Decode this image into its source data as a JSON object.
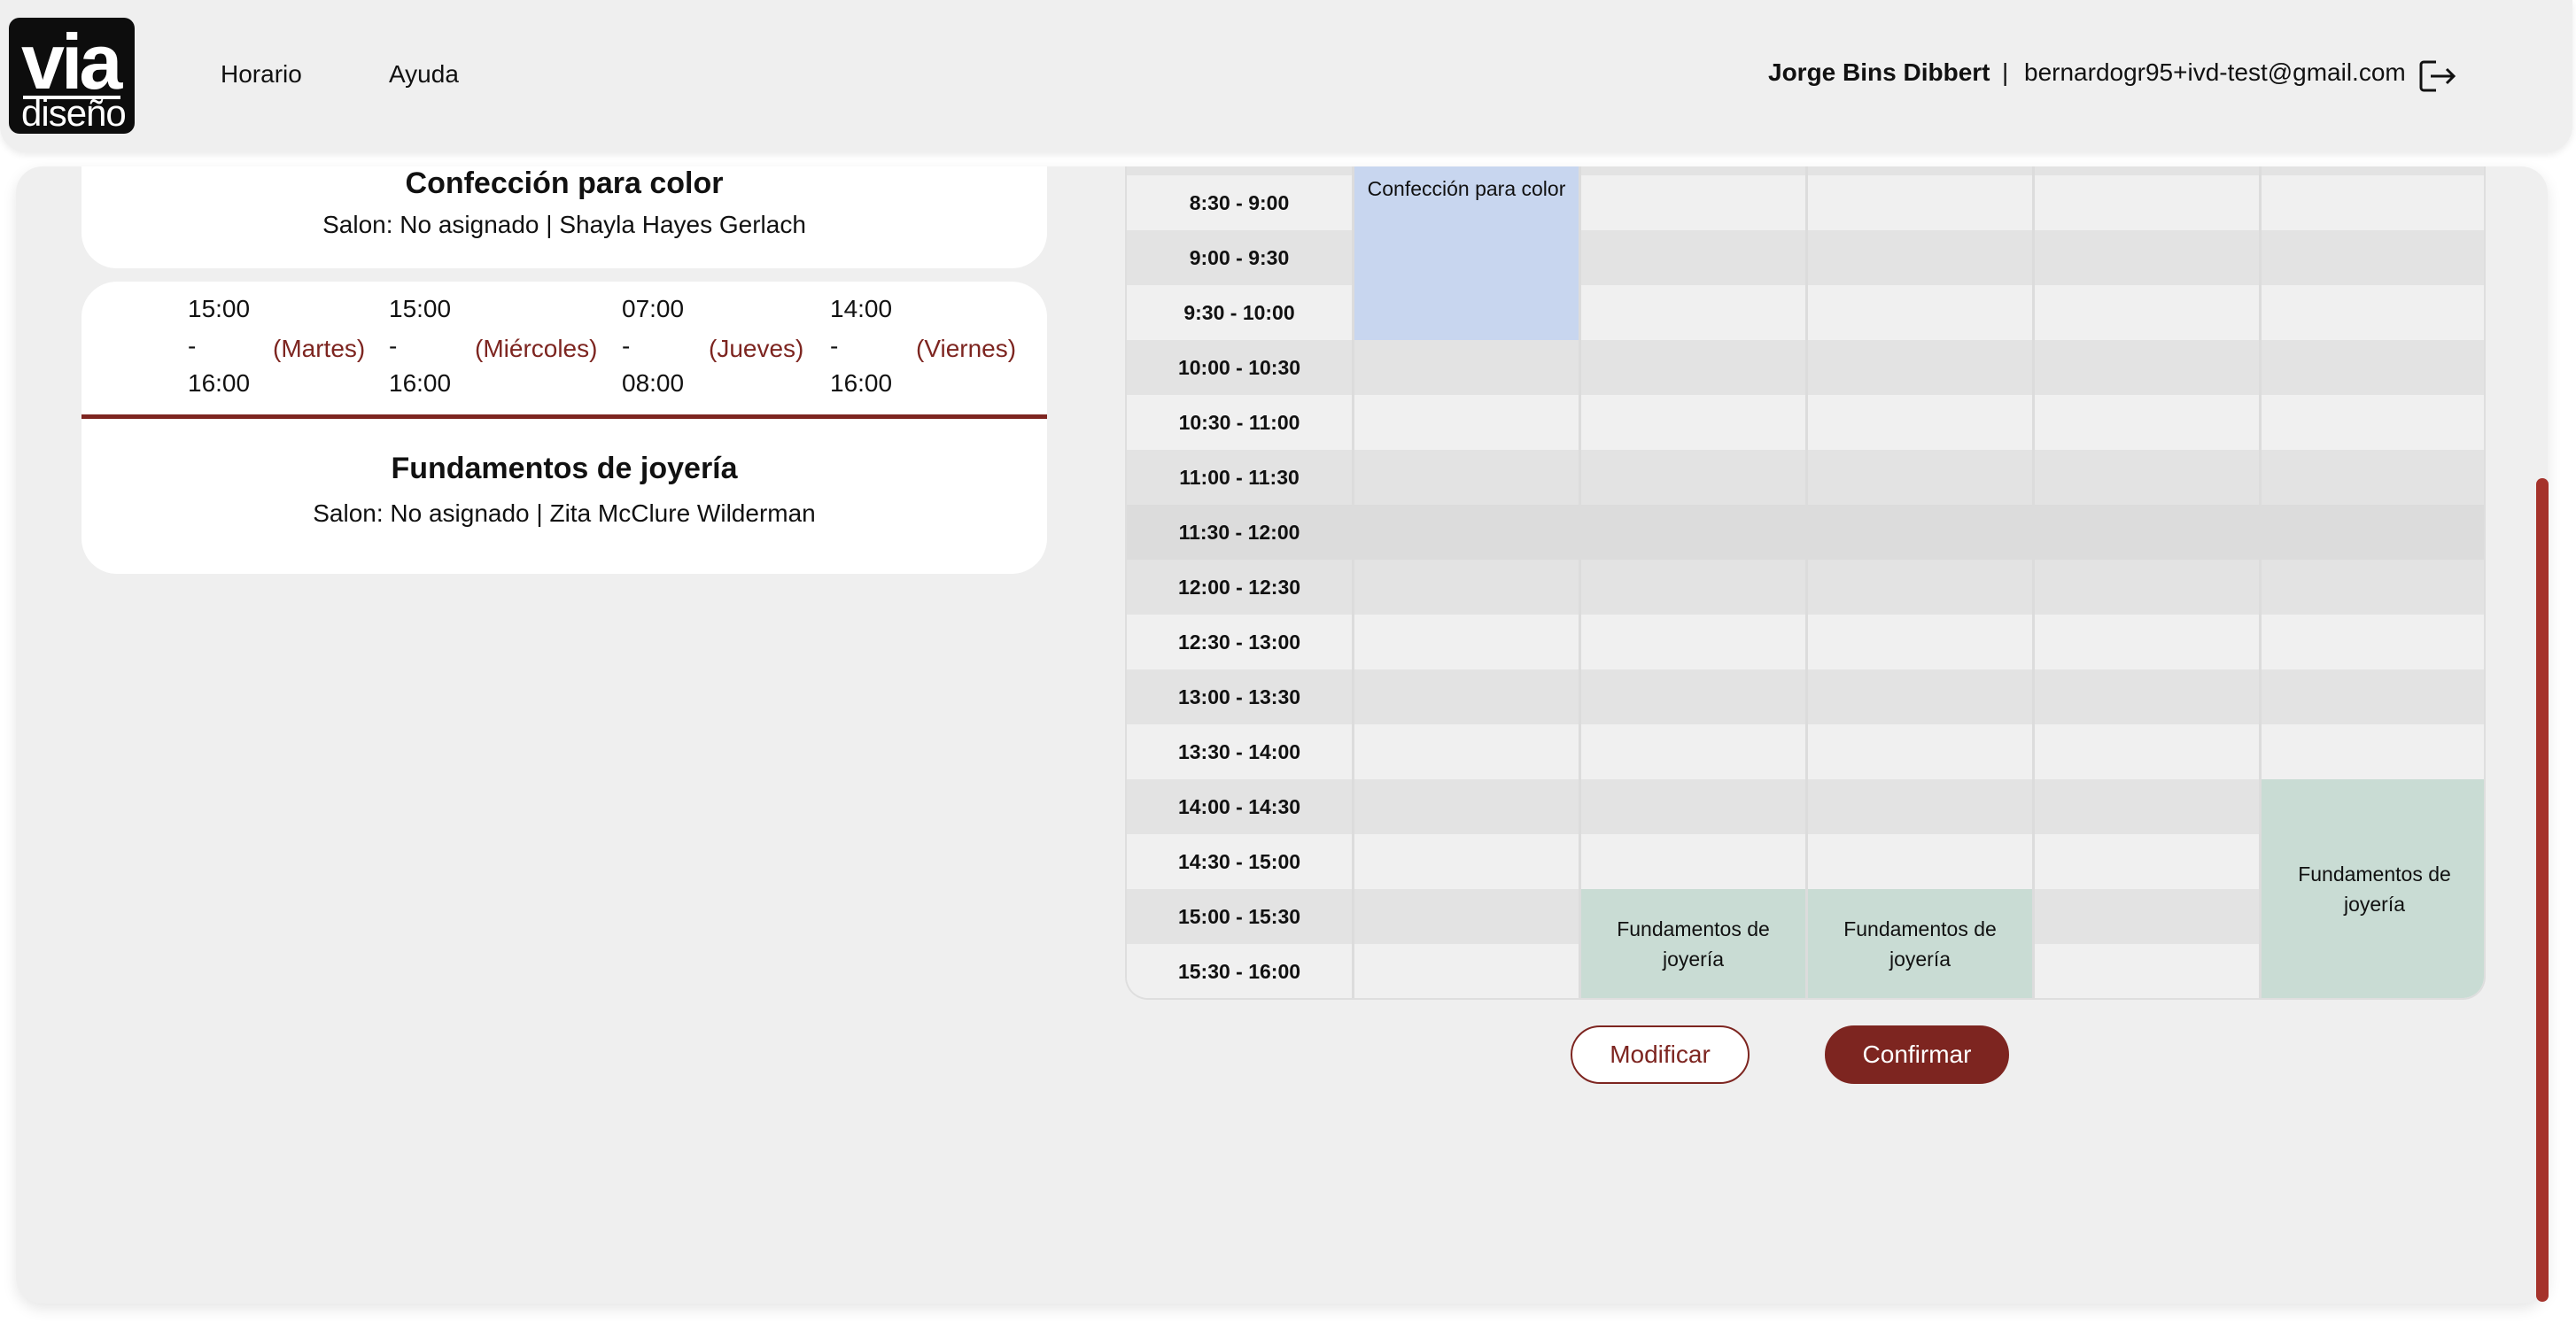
{
  "header": {
    "logo_top": "via",
    "logo_bottom": "diseño",
    "nav": [
      "Horario",
      "Ayuda"
    ],
    "user_name": "Jorge Bins Dibbert",
    "separator": "|",
    "user_email": "bernardogr95+ivd-test@gmail.com",
    "logout_icon": "logout-icon"
  },
  "courses": [
    {
      "title": "Confección para color",
      "subtitle": "Salon: No asignado | Shayla Hayes Gerlach"
    },
    {
      "title": "Fundamentos de joyería",
      "subtitle": "Salon: No asignado | Zita McClure Wilderman",
      "schedule": [
        {
          "start": "15:00",
          "dash": "-",
          "end": "16:00",
          "day": "(Martes)"
        },
        {
          "start": "15:00",
          "dash": "-",
          "end": "16:00",
          "day": "(Miércoles)"
        },
        {
          "start": "07:00",
          "dash": "-",
          "end": "08:00",
          "day": "(Jueves)"
        },
        {
          "start": "14:00",
          "dash": "-",
          "end": "16:00",
          "day": "(Viernes)"
        }
      ]
    }
  ],
  "timetable": {
    "time_slots": [
      "8:30 - 9:00",
      "9:00 - 9:30",
      "9:30 - 10:00",
      "10:00 - 10:30",
      "10:30 - 11:00",
      "11:00 - 11:30",
      "11:30 - 12:00",
      "12:00 - 12:30",
      "12:30 - 13:00",
      "13:00 - 13:30",
      "13:30 - 14:00",
      "14:00 - 14:30",
      "14:30 - 15:00",
      "15:00 - 15:30",
      "15:30 - 16:00"
    ],
    "events": [
      {
        "name": "Confección para color",
        "day_index": 0,
        "color": "#c8d6ef"
      },
      {
        "name": "Fundamentos de joyería",
        "day_index": 1,
        "color": "#c9dcd4"
      },
      {
        "name": "Fundamentos de joyería",
        "day_index": 2,
        "color": "#c9dcd4"
      },
      {
        "name": "Fundamentos de joyería",
        "day_index": 4,
        "color": "#c9dcd4"
      }
    ]
  },
  "actions": {
    "modify": "Modificar",
    "confirm": "Confirmar"
  },
  "colors": {
    "accent": "#7d2520",
    "scrollbar": "#a5322b",
    "event_blue": "#c8d6ef",
    "event_green": "#c9dcd4"
  }
}
